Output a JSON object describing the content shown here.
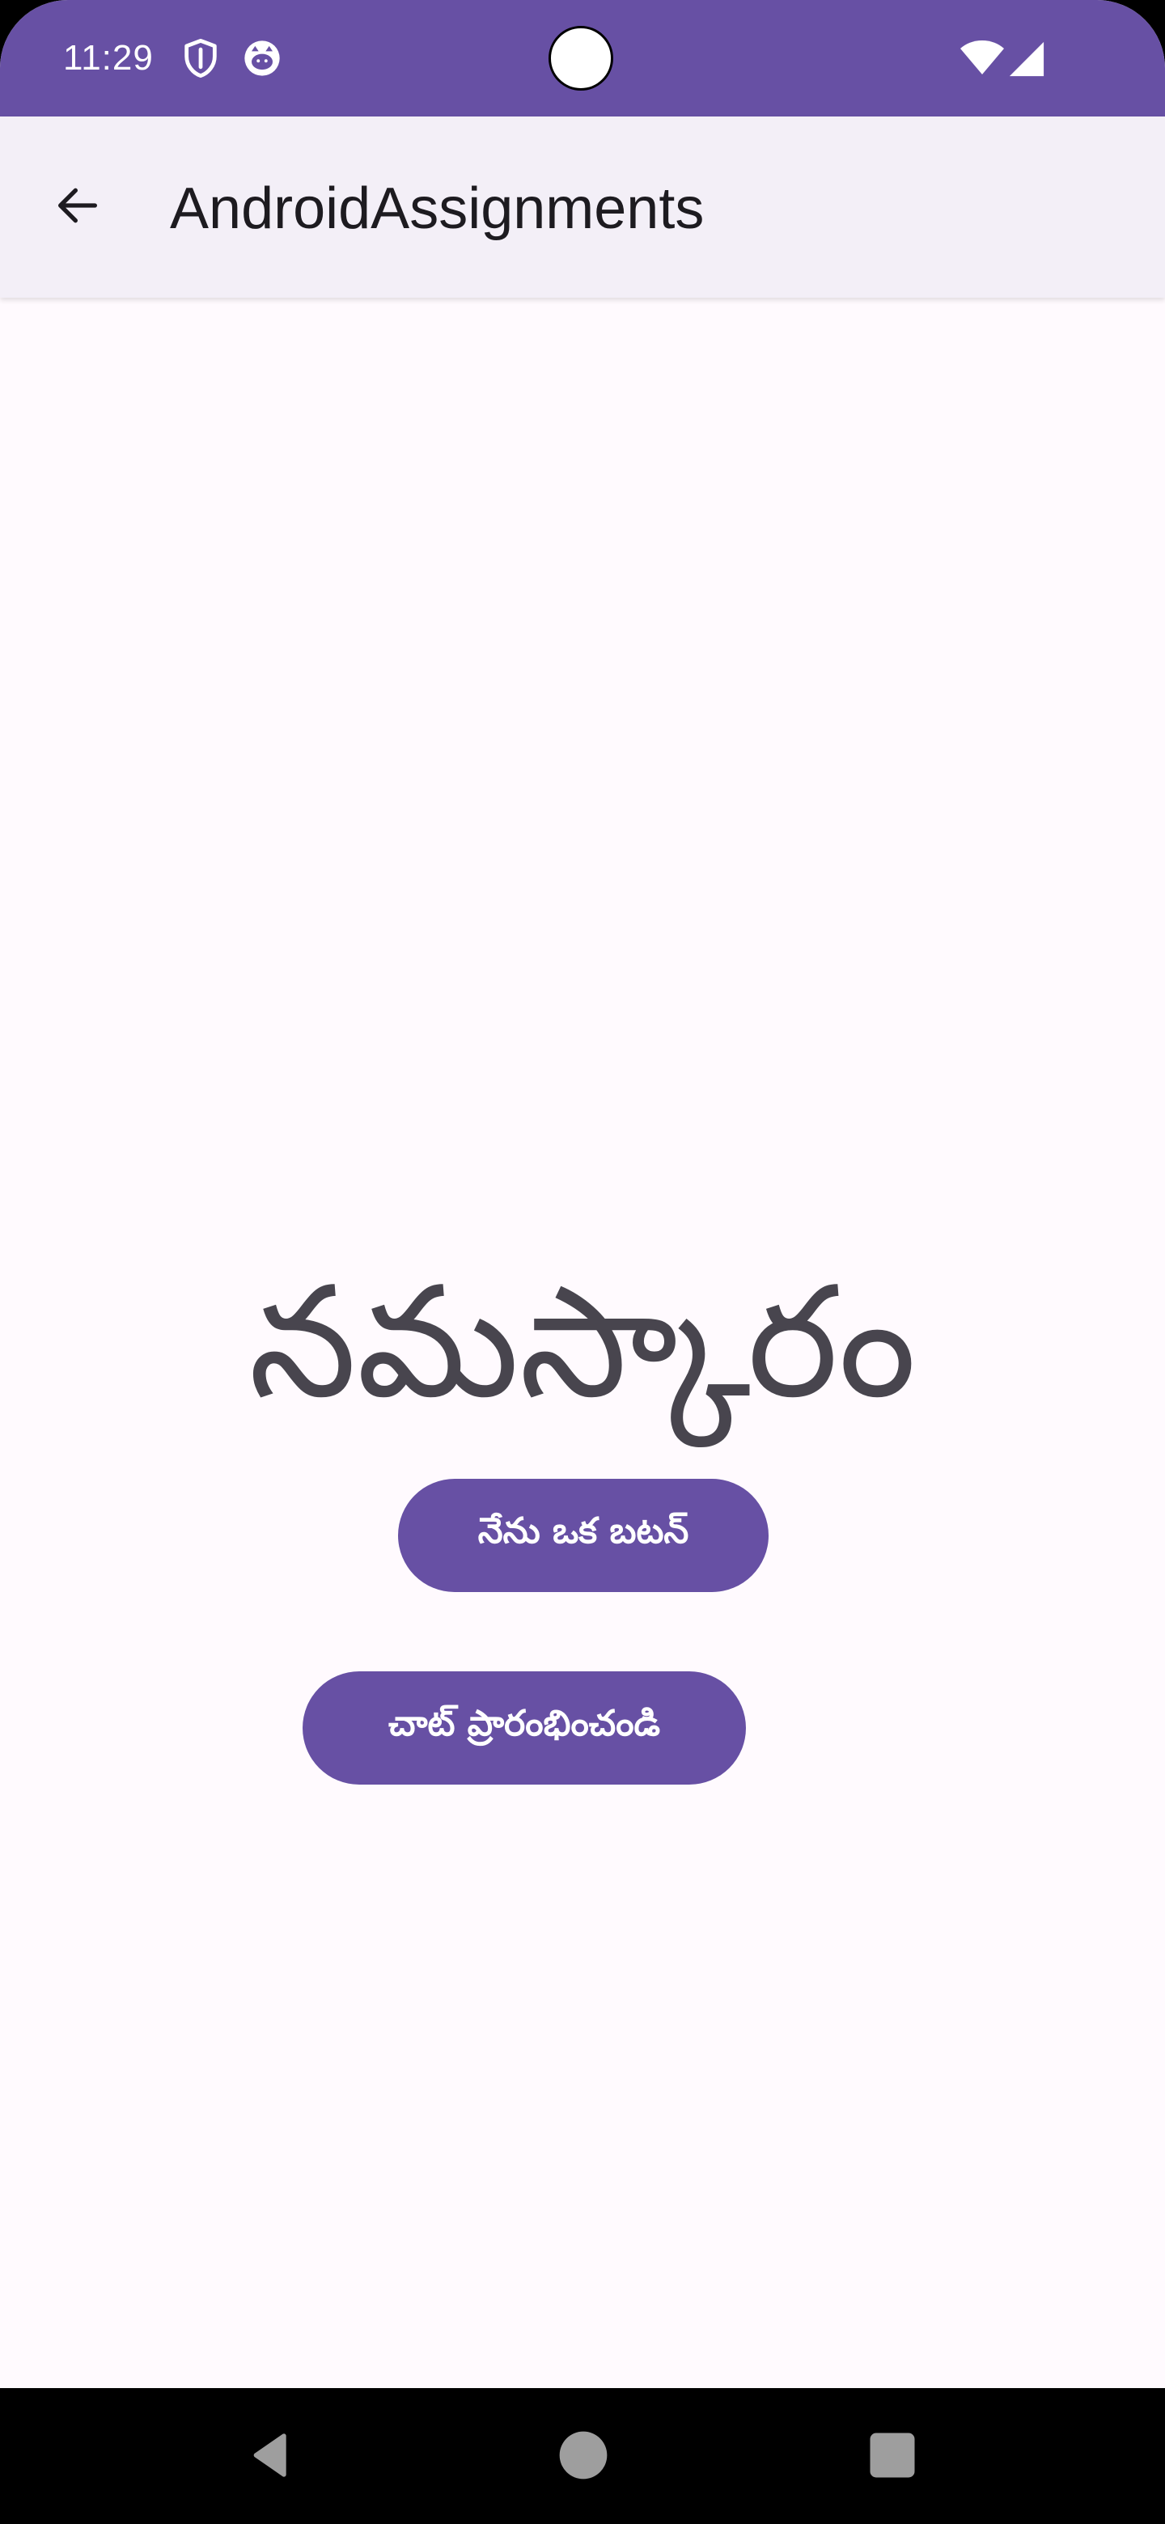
{
  "status_bar": {
    "time": "11:29",
    "icons": [
      "shield-icon",
      "cat-notification-icon",
      "wifi-icon",
      "cellular-signal-icon"
    ],
    "background": "#6750A4"
  },
  "app_bar": {
    "title": "AndroidAssignments",
    "back_icon": "arrow-back-icon",
    "background": "#F3EFF7"
  },
  "main": {
    "greeting": "నమస్కారం",
    "primary_button_label": "నేను ఒక బటన్",
    "chat_button_label": "చాట్ ప్రారంభించండి",
    "button_color": "#6750A4"
  },
  "nav_bar": {
    "items": [
      "back-triangle-icon",
      "home-circle-icon",
      "recents-square-icon"
    ]
  }
}
